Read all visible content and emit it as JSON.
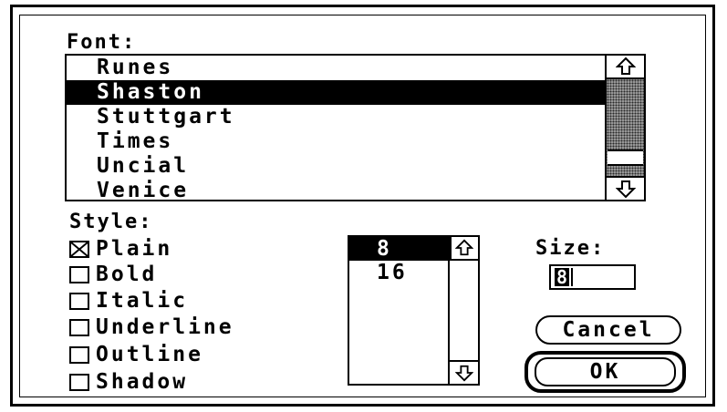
{
  "labels": {
    "font": "Font:",
    "style": "Style:",
    "size": "Size:"
  },
  "font_list": {
    "items": [
      "Runes",
      "Shaston",
      "Stuttgart",
      "Times",
      "Uncial",
      "Venice"
    ],
    "selected": "Shaston",
    "scroll_position": 0.88
  },
  "style_options": [
    {
      "label": "Plain",
      "checked": true
    },
    {
      "label": "Bold",
      "checked": false
    },
    {
      "label": "Italic",
      "checked": false
    },
    {
      "label": "Underline",
      "checked": false
    },
    {
      "label": "Outline",
      "checked": false
    },
    {
      "label": "Shadow",
      "checked": false
    }
  ],
  "size_list": {
    "items": [
      "8",
      "16"
    ],
    "selected": "8"
  },
  "size_field": {
    "value": "8"
  },
  "buttons": {
    "cancel": "Cancel",
    "ok": "OK"
  },
  "icons": {
    "scroll_up": "up-arrow-icon",
    "scroll_down": "down-arrow-icon",
    "check": "x-check-icon"
  },
  "colors": {
    "background": "#ffffff",
    "foreground": "#000000",
    "scroll_track": "#9a9a9a"
  }
}
